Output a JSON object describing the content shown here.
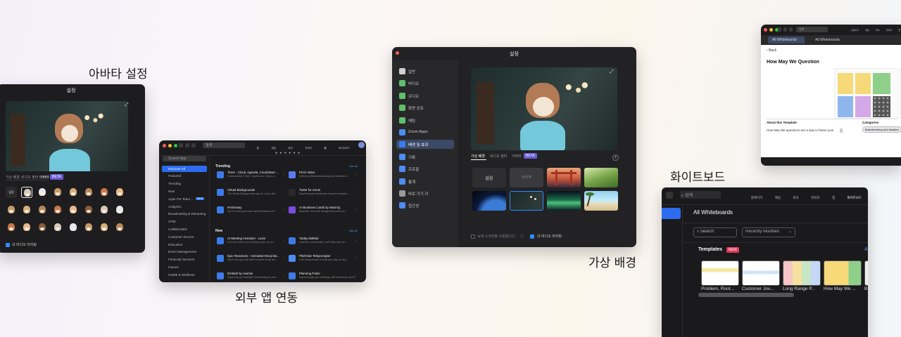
{
  "captions": {
    "avatar": "아바타 설정",
    "apps": "외부 앱 연동",
    "background": "가상 배경",
    "whiteboard": "화이트보드"
  },
  "avatar_window": {
    "title": "설정",
    "tabs": [
      "가상 배경",
      "비디오 필터",
      "아바타"
    ],
    "beta": "BETA",
    "none_label": "없음",
    "mirror_label": "내 비디오 미러링"
  },
  "apps_window": {
    "search": "검색",
    "nav": [
      "홈",
      "채팅",
      "회의",
      "연락처",
      "앱",
      "화이트보드"
    ],
    "sidebar_search": "Search App",
    "sidebar": [
      "Discover All",
      "Featured",
      "Trending",
      "New",
      "Apps For Team...",
      "Analytics",
      "Broadcasting & Streaming",
      "CRM",
      "Collaboration",
      "Customer Service",
      "Education",
      "Event Management",
      "Financial Services",
      "Games",
      "Health & Wellness"
    ],
    "new_badge": "NEW",
    "trending_title": "Trending",
    "new_title": "New",
    "see_all": "See All",
    "trending": [
      {
        "name": "Timer - Clock, Agenda, Countdown ...",
        "desc": "Customizable Timer, Countdown, Clock, A..."
      },
      {
        "name": "Prezi Video",
        "desc": "Deliver professional-looking and branded v..."
      },
      {
        "name": "Virtual Backgrounds",
        "desc": "The Virtual Backgrounds app for Zoom allo..."
      },
      {
        "name": "Twine for Zoom",
        "desc": "Supercharged breakouts & speed networki..."
      },
      {
        "name": "#AskAway",
        "desc": "Get to know your team with thousands of f..."
      },
      {
        "name": "AI Business Cards by Warmly,",
        "desc": "Beautiful, real-time backgrounds with per..."
      }
    ],
    "new": [
      {
        "name": "AI Meeting Assistant - Laxis",
        "desc": "Let Laxis write your meeting notes, so yo..."
      },
      {
        "name": "Tactiq Sidebar",
        "desc": "Load the conversation, we'll take care of t..."
      },
      {
        "name": "Epic Reactions - Animated Emoji Ba...",
        "desc": "Show how you feel with real-time emoji ani..."
      },
      {
        "name": "PitchHub Teleprompter",
        "desc": "Free teleprompter to help you stay on trac..."
      },
      {
        "name": "Embark by Harmis",
        "desc": "Supercharge Employee Onboarding by hav..."
      },
      {
        "name": "Planning Poker",
        "desc": "Supercharge your meetings with businesse card it..."
      }
    ]
  },
  "bg_window": {
    "title": "설정",
    "sidebar": [
      "일반",
      "비디오",
      "오디오",
      "화면 공유",
      "채팅",
      "Zoom Apps",
      "배경 및 효과",
      "기록",
      "프로필",
      "통계",
      "바로 가기 키",
      "접근성"
    ],
    "tabs": [
      "가상 배경",
      "비디오 필터",
      "아바타"
    ],
    "beta": "BETA",
    "none_label": "없음",
    "blur_label": "흐리게",
    "green_label": "녹색 스크린을 사용합니다",
    "mirror_label": "내 비디오 미러링",
    "colors": {
      "accent": "#2d8cff",
      "selected": "#3a4a66"
    }
  },
  "wb_small": {
    "search": "검색",
    "nav": [
      "홈페이지",
      "채팅",
      "회의",
      "연락처",
      "앱",
      "화이트보드"
    ],
    "tab": "All Whiteboards",
    "back": "Back",
    "title": "How May We Question",
    "about": "About this Template",
    "desc": "How May We questions are a way to frame your",
    "categories": "Categories",
    "tag": "Brainstorming and Ideation"
  },
  "wb_big": {
    "search": "검색",
    "nav": [
      "홈페이지",
      "채팅",
      "회의",
      "연락처",
      "앱",
      "화이트보드"
    ],
    "header": "All Whiteboards",
    "search_placeholder": "Search",
    "sort": "Recently Modified",
    "templates": "Templates",
    "new_badge": "NEW",
    "cards": [
      "Problem, Root...",
      "Customer Jou...",
      "Long Range P...",
      "How May We ...",
      "B..."
    ]
  }
}
